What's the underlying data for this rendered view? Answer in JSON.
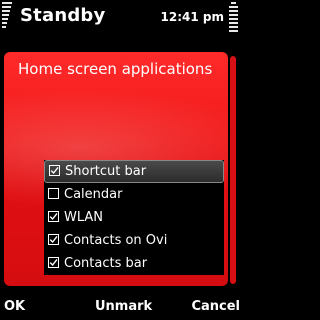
{
  "status_bar": {
    "title": "Standby",
    "clock": "12:41 pm"
  },
  "panel": {
    "heading": "Home screen applications"
  },
  "options": [
    {
      "label": "Shortcut bar",
      "checked": true,
      "highlighted": true
    },
    {
      "label": "Calendar",
      "checked": false,
      "highlighted": false
    },
    {
      "label": "WLAN",
      "checked": true,
      "highlighted": false
    },
    {
      "label": "Contacts on Ovi",
      "checked": true,
      "highlighted": false
    },
    {
      "label": "Contacts bar",
      "checked": true,
      "highlighted": false
    }
  ],
  "softkeys": {
    "left": "OK",
    "middle": "Unmark",
    "right": "Cancel"
  },
  "colors": {
    "panel_red": "#e8141a",
    "background": "#000000",
    "text": "#ffffff"
  },
  "icons": {
    "signal": "signal-strength-icon",
    "battery": "battery-level-icon",
    "checkbox": "checkbox-icon"
  }
}
